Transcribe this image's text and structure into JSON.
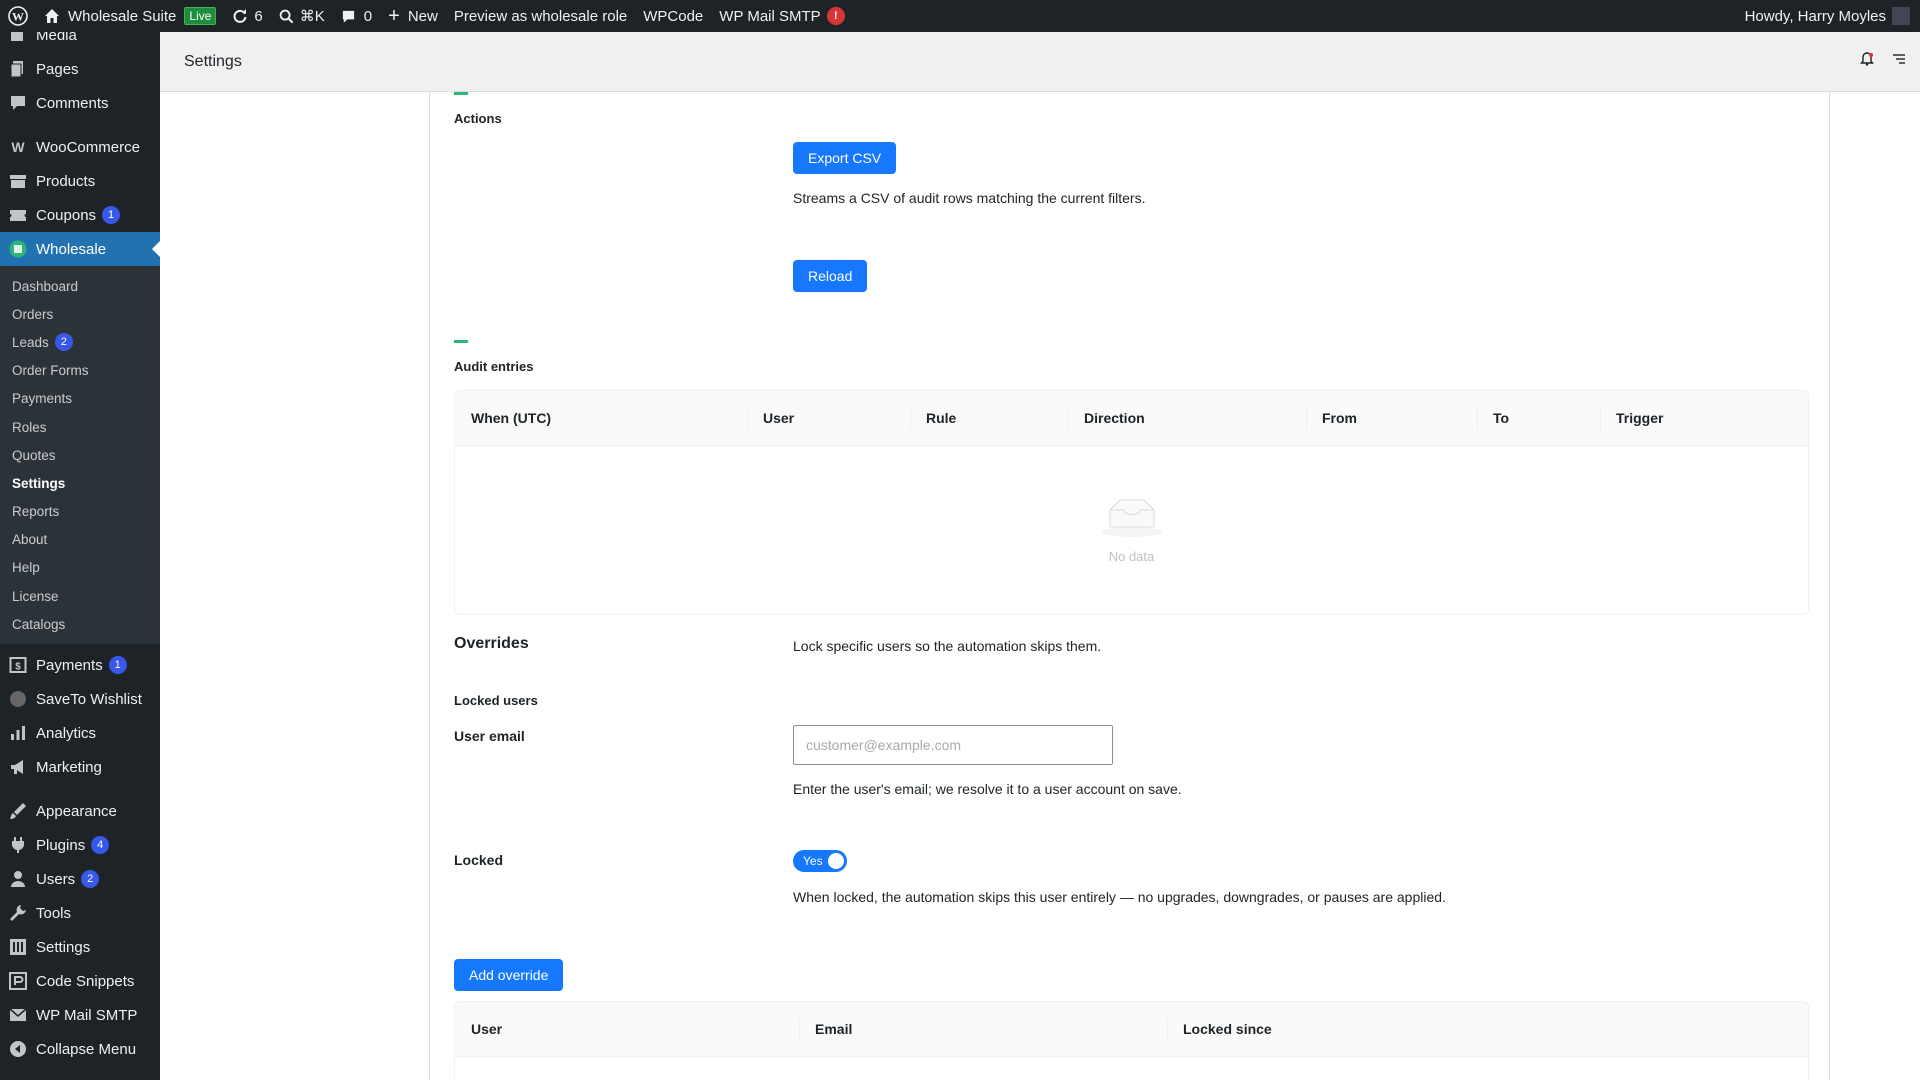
{
  "adminbar": {
    "site_name": "Wholesale Suite",
    "live_badge": "Live",
    "updates_count": "6",
    "search_shortcut": "⌘K",
    "comments_count": "0",
    "new_label": "New",
    "preview_label": "Preview as wholesale role",
    "wpcode_label": "WPCode",
    "smtp_label": "WP Mail SMTP",
    "smtp_alert": "!",
    "greeting": "Howdy, Harry Moyles"
  },
  "sidebar": {
    "top_items": [
      {
        "label": "Media",
        "icon": "media-icon"
      },
      {
        "label": "Pages",
        "icon": "pages-icon"
      },
      {
        "label": "Comments",
        "icon": "comments-icon"
      }
    ],
    "woo_items": [
      {
        "label": "WooCommerce",
        "icon": "woocommerce-icon"
      },
      {
        "label": "Products",
        "icon": "products-icon"
      },
      {
        "label": "Coupons",
        "icon": "coupons-icon",
        "badge": "1"
      },
      {
        "label": "Wholesale",
        "icon": "wholesale-icon"
      }
    ],
    "submenu": [
      "Dashboard",
      "Orders",
      "Leads",
      "Order Forms",
      "Payments",
      "Roles",
      "Quotes",
      "Settings",
      "Reports",
      "About",
      "Help",
      "License",
      "Catalogs"
    ],
    "leads_badge": "2",
    "after_items": [
      {
        "label": "Payments",
        "badge": "1"
      },
      {
        "label": "SaveTo Wishlist"
      },
      {
        "label": "Analytics"
      },
      {
        "label": "Marketing"
      }
    ],
    "bottom_items": [
      {
        "label": "Appearance"
      },
      {
        "label": "Plugins",
        "badge": "4"
      },
      {
        "label": "Users",
        "badge": "2"
      },
      {
        "label": "Tools"
      },
      {
        "label": "Settings"
      },
      {
        "label": "Code Snippets"
      },
      {
        "label": "WP Mail SMTP"
      },
      {
        "label": "Collapse Menu"
      }
    ]
  },
  "page": {
    "title": "Settings"
  },
  "actions": {
    "section_label": "Actions",
    "export_label": "Export CSV",
    "export_desc": "Streams a CSV of audit rows matching the current filters.",
    "reload_label": "Reload"
  },
  "audit": {
    "section_label": "Audit entries",
    "columns": [
      "When (UTC)",
      "User",
      "Rule",
      "Direction",
      "From",
      "To",
      "Trigger"
    ],
    "empty_text": "No data"
  },
  "overrides": {
    "heading": "Overrides",
    "heading_desc": "Lock specific users so the automation skips them.",
    "locked_users_label": "Locked users",
    "email_label": "User email",
    "email_placeholder": "customer@example.com",
    "email_value": "",
    "email_help": "Enter the user's email; we resolve it to a user account on save.",
    "locked_label": "Locked",
    "toggle_text": "Yes",
    "toggle_on": true,
    "locked_help": "When locked, the automation skips this user entirely — no upgrades, downgrades, or pauses are applied.",
    "add_button": "Add override",
    "columns": [
      "User",
      "Email",
      "Locked since"
    ]
  },
  "colors": {
    "primary": "#1677ff",
    "admin_dark": "#1d2327",
    "menu_current": "#2271b1",
    "section_accent": "#2eb57a",
    "badge": "#3858e9"
  }
}
